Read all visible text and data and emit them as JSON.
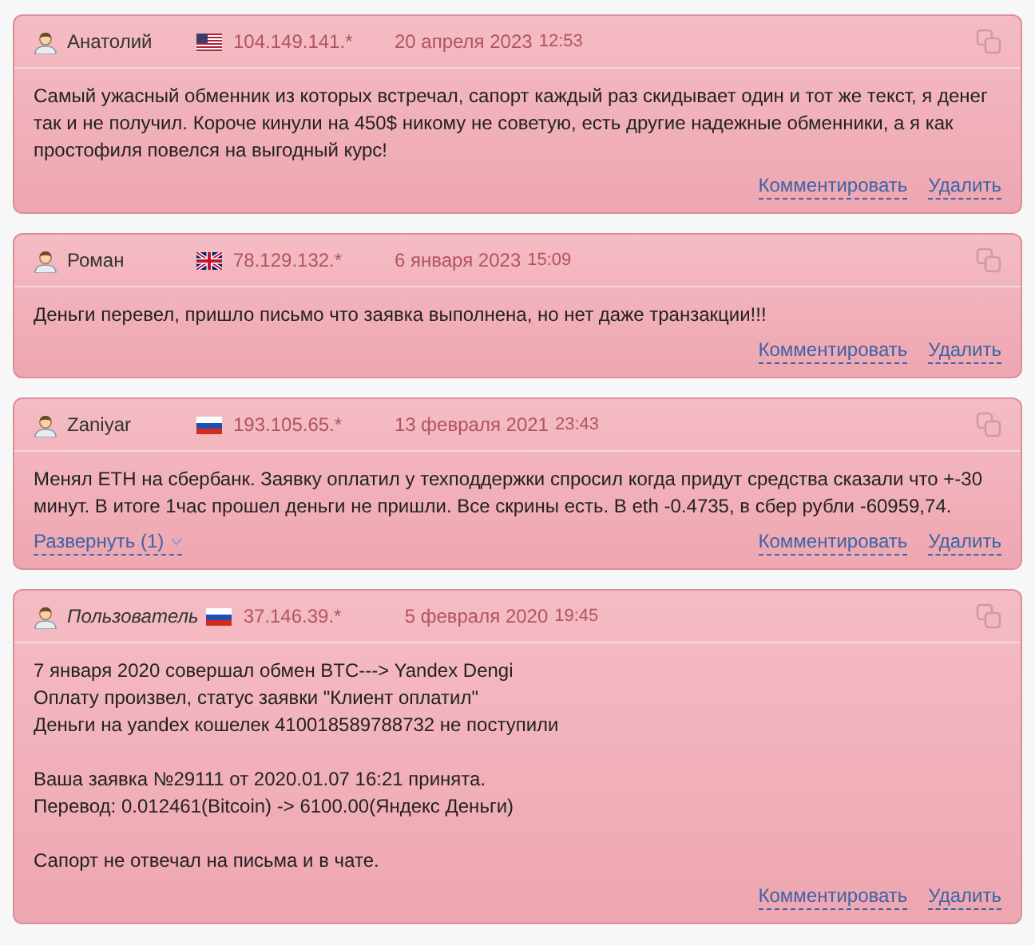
{
  "reviews": [
    {
      "author": "Анатолий",
      "guest": false,
      "flag": {
        "kind": "us"
      },
      "ip": "104.149.141.*",
      "date": "20 апреля 2023",
      "time": "12:53",
      "paragraphs": [
        [
          "Самый ужасный обменник из которых встречал, сапорт каждый раз скидывает один и тот же текст, я денег так и не получил. Короче кинули на 450$ никому не советую, есть другие надежные обменники, а я как простофиля повелся на выгодный курс!"
        ]
      ],
      "actions": [
        "Комментировать",
        "Удалить"
      ]
    },
    {
      "author": "Роман",
      "guest": false,
      "flag": {
        "kind": "gb"
      },
      "ip": "78.129.132.*",
      "date": "6 января 2023",
      "time": "15:09",
      "paragraphs": [
        [
          "Деньги перевел, пришло письмо что заявка выполнена, но нет даже транзакции!!!"
        ]
      ],
      "actions": [
        "Комментировать",
        "Удалить"
      ]
    },
    {
      "author": "Zaniyar",
      "guest": false,
      "flag": {
        "kind": "ru"
      },
      "ip": "193.105.65.*",
      "date": "13 февраля 2021",
      "time": "23:43",
      "paragraphs": [
        [
          "Менял ETH на сбербанк. Заявку оплатил у техподдержки спросил когда придут средства сказали что +-30 минут. В итоге 1час прошел деньги не пришли. Все скрины есть. В eth -0.4735, в сбер рубли -60959,74."
        ]
      ],
      "expand": "Развернуть (1)",
      "actions": [
        "Комментировать",
        "Удалить"
      ]
    },
    {
      "author": "Пользователь",
      "guest": true,
      "flag": {
        "kind": "ru"
      },
      "ip": "37.146.39.*",
      "date": "5 февраля 2020",
      "time": "19:45",
      "paragraphs": [
        [
          "7 января 2020 совершал обмен BTC---> Yandex Dengi",
          "Оплату произвел, статус заявки \"Клиент оплатил\"",
          "Деньги на yandex кошелек 410018589788732 не поступили"
        ],
        [
          "Ваша заявка №29111 от 2020.01.07 16:21 принята.",
          "Перевод: 0.012461(Bitcoin) -> 6100.00(Яндекс Деньги)"
        ],
        [
          "Сапорт не отвечал на письма и в чате."
        ]
      ],
      "actions": [
        "Комментировать",
        "Удалить"
      ]
    }
  ]
}
